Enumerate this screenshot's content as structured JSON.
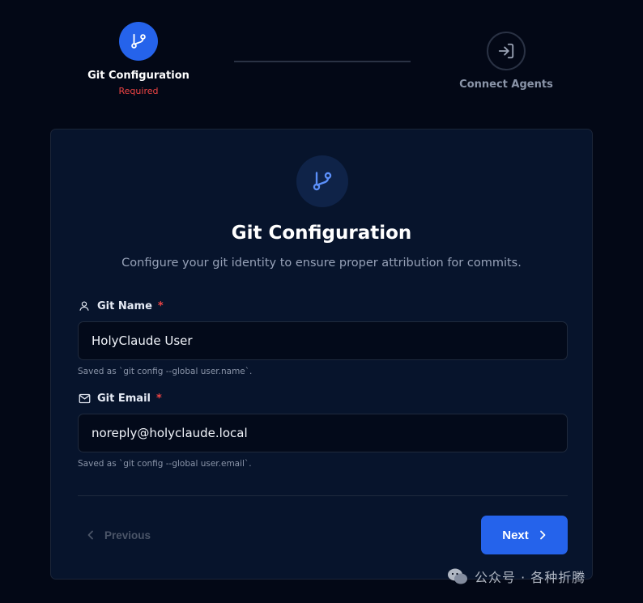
{
  "stepper": {
    "steps": [
      {
        "title": "Git Configuration",
        "status": "Required",
        "icon": "git-branch-icon",
        "state": "active"
      },
      {
        "title": "Connect Agents",
        "icon": "sign-in-icon",
        "state": "pending"
      }
    ]
  },
  "card": {
    "icon": "git-branch-icon",
    "title": "Git Configuration",
    "description": "Configure your git identity to ensure proper attribution for commits."
  },
  "form": {
    "name_field": {
      "label": "Git Name",
      "required_mark": "*",
      "value": "HolyClaude User",
      "hint": "Saved as `git config --global user.name`.",
      "icon": "user-icon"
    },
    "email_field": {
      "label": "Git Email",
      "required_mark": "*",
      "value": "noreply@holyclaude.local",
      "hint": "Saved as `git config --global user.email`.",
      "icon": "mail-icon"
    }
  },
  "actions": {
    "previous_label": "Previous",
    "next_label": "Next"
  },
  "watermark": {
    "text": "公众号 · 各种折腾"
  },
  "colors": {
    "background": "#030816",
    "card": "#07142c",
    "accent": "#2563eb",
    "required": "#ef4444"
  }
}
